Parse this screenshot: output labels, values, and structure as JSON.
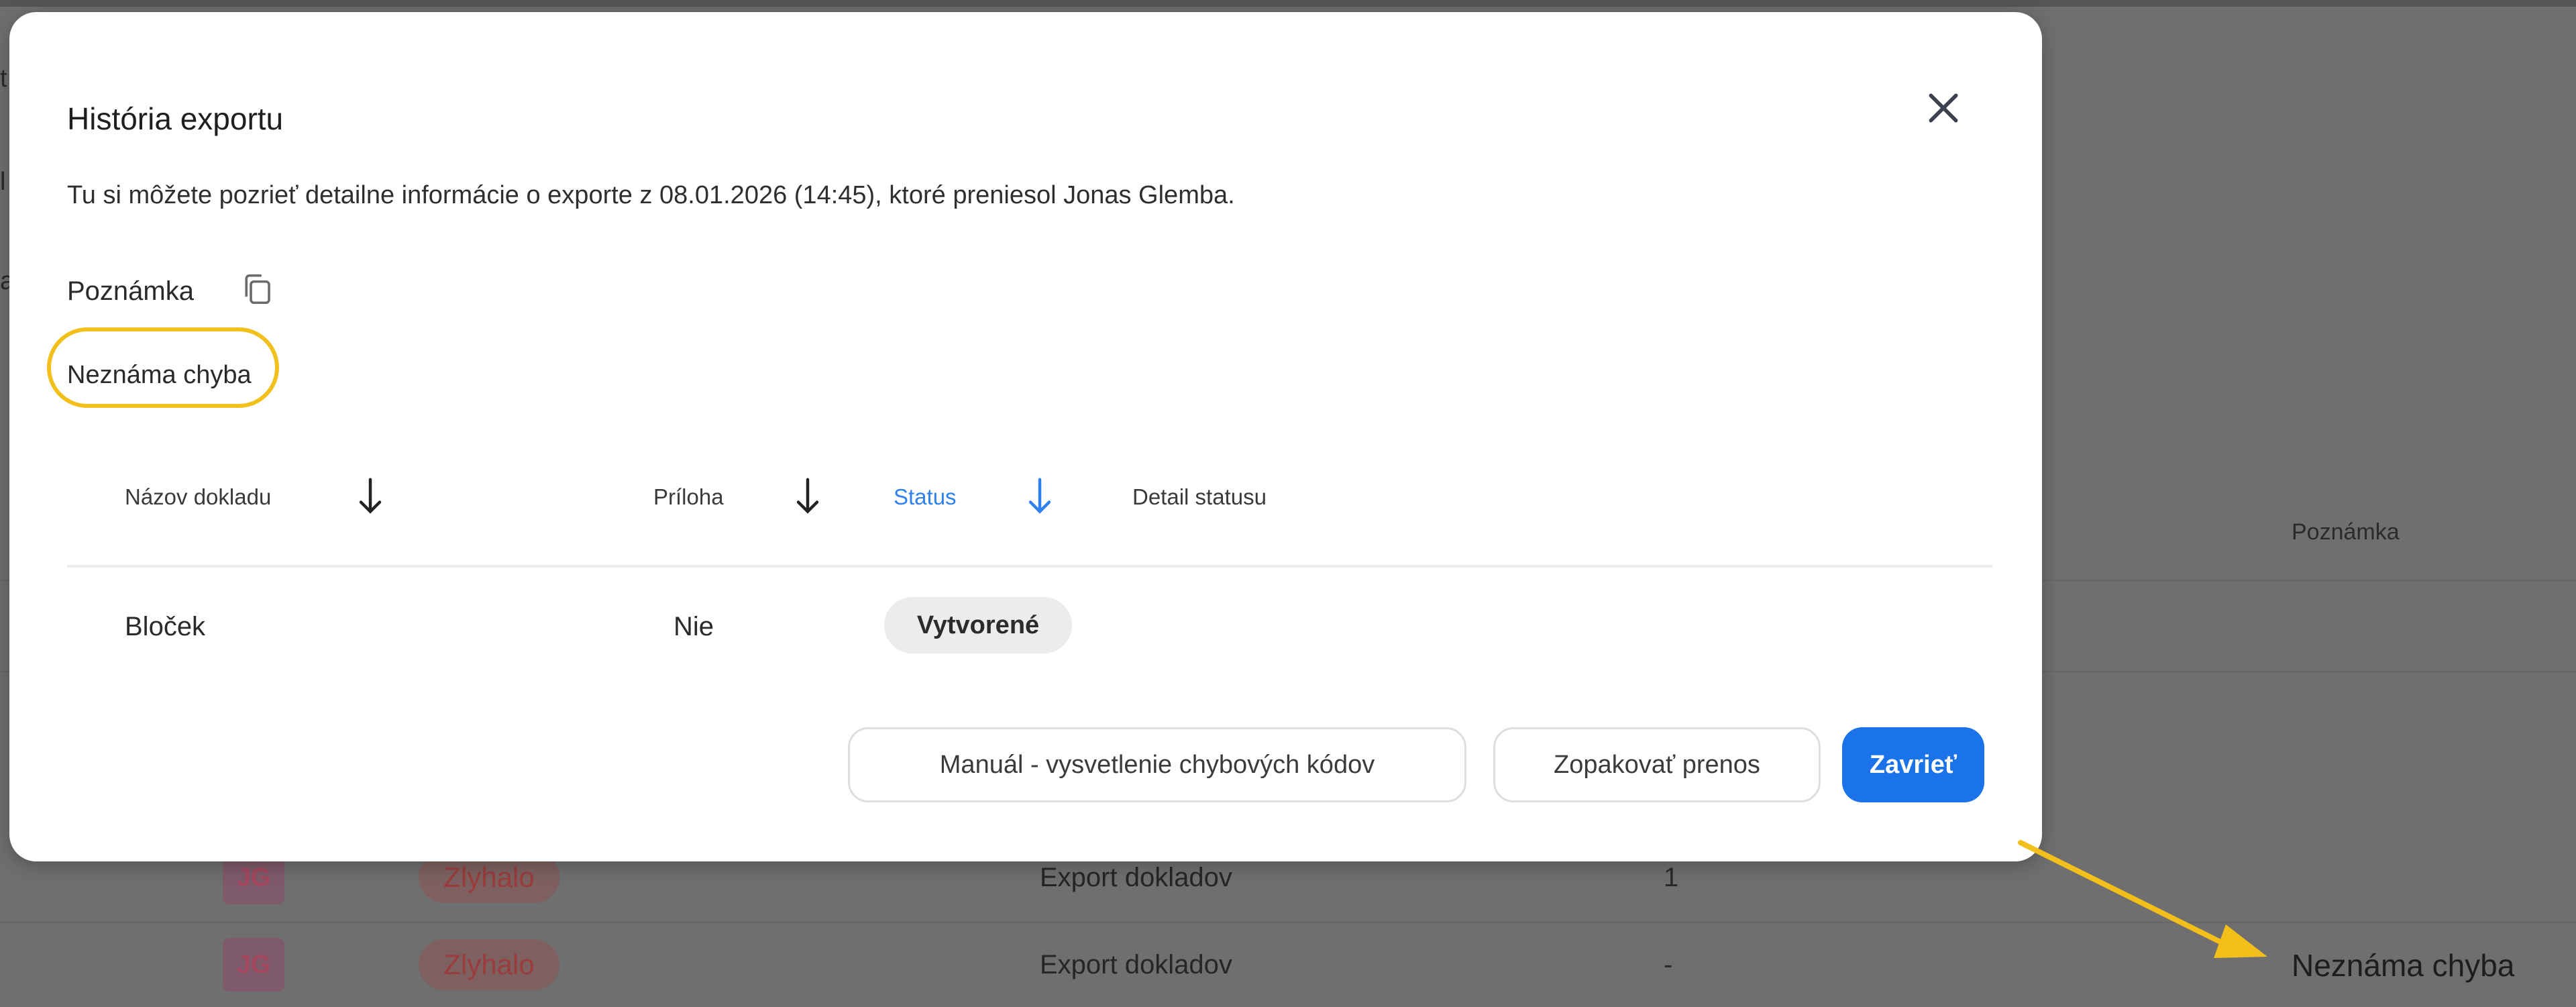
{
  "colors": {
    "accent": "#1a73e8",
    "highlight": "#f3bf1a",
    "status_active": "#2f80ed"
  },
  "background": {
    "left_fragments": [
      "t",
      "l",
      "a"
    ],
    "column_header": "Poznámka",
    "rows": [
      {
        "avatar": "JG",
        "status": "Zlyhalo",
        "type": "Export dokladov",
        "count": "1"
      },
      {
        "avatar": "JG",
        "status": "Zlyhalo",
        "type": "Export dokladov",
        "count": "-"
      }
    ],
    "callout_note": "Neznáma chyba"
  },
  "modal": {
    "title": "História exportu",
    "close_icon": "close-icon",
    "description": "Tu si môžete pozrieť detailne informácie o exporte z 08.01.2026 (14:45), ktoré preniesol Jonas Glemba.",
    "note_label": "Poznámka",
    "copy_icon": "copy-icon",
    "note_text": "Neznáma chyba",
    "table": {
      "headers": [
        "Názov dokladu",
        "Príloha",
        "Status",
        "Detail statusu"
      ],
      "sort_icon": "arrow-down-icon",
      "rows": [
        {
          "name": "Bloček",
          "attachment": "Nie",
          "status": "Vytvorené",
          "detail": ""
        }
      ]
    },
    "buttons": {
      "manual": "Manuál - vysvetlenie chybových kódov",
      "retry": "Zopakovať prenos",
      "close": "Zavrieť"
    }
  }
}
